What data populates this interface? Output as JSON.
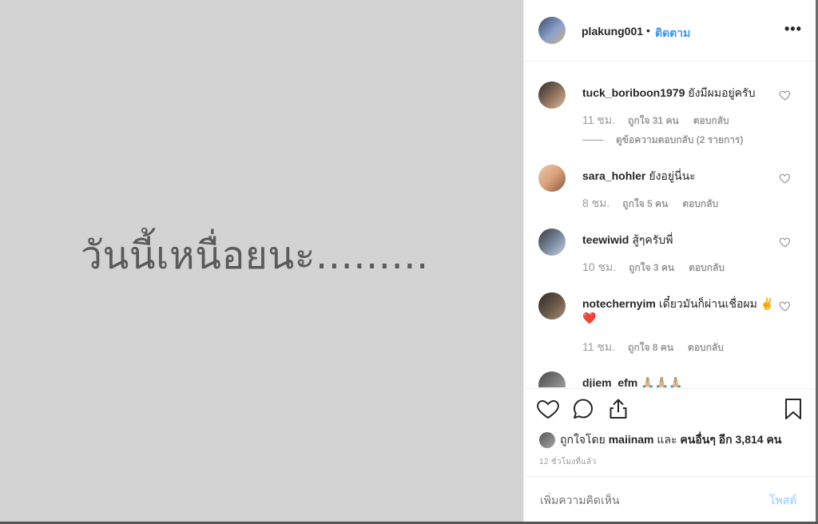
{
  "post": {
    "image_text": "วันนี้เหนื่อยนะ........."
  },
  "header": {
    "username": "plakung001",
    "separator": "•",
    "follow_label": "ติดตาม",
    "more_icon": "more-horizontal-icon"
  },
  "comments": [
    {
      "username": "tuck_boriboon1979",
      "text": "ยังมีผมอยู่ครับ",
      "time": "11 ชม.",
      "likes": "ถูกใจ 31 คน",
      "reply": "ตอบกลับ",
      "view_replies": "ดูข้อความตอบกลับ (2 รายการ)"
    },
    {
      "username": "sara_hohler",
      "text": "ยังอยู่นี่นะ",
      "time": "8 ชม.",
      "likes": "ถูกใจ 5 คน",
      "reply": "ตอบกลับ"
    },
    {
      "username": "teewiwid",
      "text": "สู้ๆครับพี่",
      "time": "10 ชม.",
      "likes": "ถูกใจ 3 คน",
      "reply": "ตอบกลับ"
    },
    {
      "username": "notechernyim",
      "text": "เดี๋ยวมันก็ผ่านเชื่อผม ✌️❤️",
      "time": "11 ชม.",
      "likes": "ถูกใจ 8 คน",
      "reply": "ตอบกลับ"
    },
    {
      "username": "djiem_efm",
      "text": "🙏🏼🙏🏼🙏🏼"
    }
  ],
  "actions": {
    "like_icon": "heart-icon",
    "comment_icon": "comment-icon",
    "share_icon": "share-icon",
    "save_icon": "bookmark-icon"
  },
  "likes_summary": {
    "prefix": "ถูกใจโดย",
    "user": "maiinam",
    "and": "และ",
    "others": "คนอื่นๆ อีก 3,814 คน"
  },
  "timestamp": "12 ชั่วโมงที่แล้ว",
  "add_comment": {
    "placeholder": "เพิ่มความคิดเห็น",
    "post_label": "โพสต์"
  },
  "colors": {
    "link_blue": "#3897f0",
    "post_disabled": "#b3dbff",
    "image_bg": "#d3d3d3"
  }
}
